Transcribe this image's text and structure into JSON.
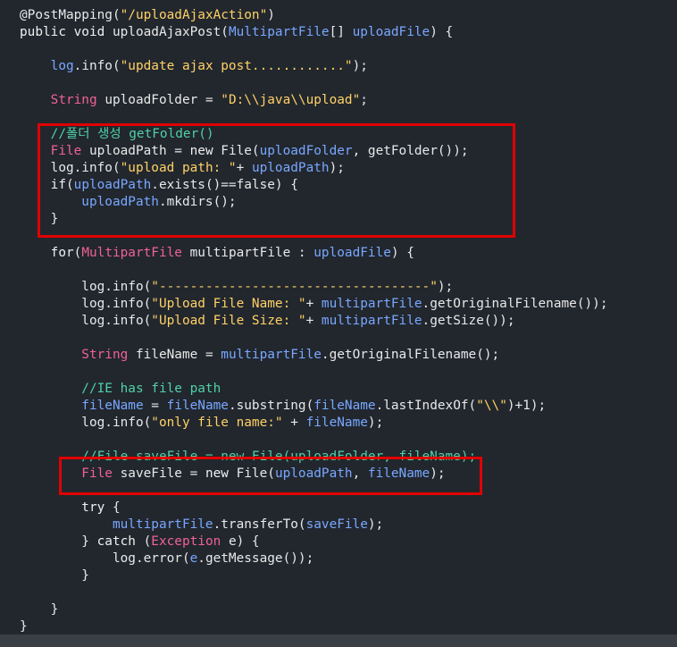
{
  "editor": {
    "background": "#22272e",
    "colors": {
      "keyword": "#f0f0f0",
      "type": "#f06292",
      "string": "#ffd166",
      "identifier": "#79a7ff",
      "comment": "#4fd1a5",
      "plain": "#e8e8e8",
      "highlight_border": "#e00000"
    },
    "lines": [
      [
        [
          "plain",
          "@PostMapping("
        ],
        [
          "string",
          "\"/uploadAjaxAction\""
        ],
        [
          "plain",
          ")"
        ]
      ],
      [
        [
          "keyword",
          "public void "
        ],
        [
          "plain",
          "uploadAjaxPost("
        ],
        [
          "identifier",
          "MultipartFile"
        ],
        [
          "plain",
          "[] "
        ],
        [
          "identifier",
          "uploadFile"
        ],
        [
          "plain",
          ") {"
        ]
      ],
      [],
      [
        [
          "identifier",
          "    log"
        ],
        [
          "plain",
          ".info("
        ],
        [
          "string",
          "\"update ajax post............\""
        ],
        [
          "plain",
          ");"
        ]
      ],
      [],
      [
        [
          "type",
          "    String "
        ],
        [
          "plain",
          "uploadFolder = "
        ],
        [
          "string",
          "\"D:\\\\java\\\\upload\""
        ],
        [
          "plain",
          ";"
        ]
      ],
      [],
      [
        [
          "comment",
          "    //폴더 생성 getFolder()"
        ]
      ],
      [
        [
          "type",
          "    File "
        ],
        [
          "plain",
          "uploadPath = "
        ],
        [
          "keyword",
          "new "
        ],
        [
          "plain",
          "File("
        ],
        [
          "identifier",
          "uploadFolder"
        ],
        [
          "plain",
          ", getFolder());"
        ]
      ],
      [
        [
          "plain",
          "    log.info("
        ],
        [
          "string",
          "\"upload path: \""
        ],
        [
          "plain",
          "+ "
        ],
        [
          "identifier",
          "uploadPath"
        ],
        [
          "plain",
          ");"
        ]
      ],
      [
        [
          "keyword",
          "    if"
        ],
        [
          "plain",
          "("
        ],
        [
          "identifier",
          "uploadPath"
        ],
        [
          "plain",
          ".exists()==false) {"
        ]
      ],
      [
        [
          "identifier",
          "        uploadPath"
        ],
        [
          "plain",
          ".mkdirs();"
        ]
      ],
      [
        [
          "plain",
          "    }"
        ]
      ],
      [],
      [
        [
          "keyword",
          "    for"
        ],
        [
          "plain",
          "("
        ],
        [
          "type",
          "MultipartFile "
        ],
        [
          "plain",
          "multipartFile : "
        ],
        [
          "identifier",
          "uploadFile"
        ],
        [
          "plain",
          ") {"
        ]
      ],
      [],
      [
        [
          "plain",
          "        log.info("
        ],
        [
          "string",
          "\"-----------------------------------\""
        ],
        [
          "plain",
          ");"
        ]
      ],
      [
        [
          "plain",
          "        log.info("
        ],
        [
          "string",
          "\"Upload File Name: \""
        ],
        [
          "plain",
          "+ "
        ],
        [
          "identifier",
          "multipartFile"
        ],
        [
          "plain",
          ".getOriginalFilename());"
        ]
      ],
      [
        [
          "plain",
          "        log.info("
        ],
        [
          "string",
          "\"Upload File Size: \""
        ],
        [
          "plain",
          "+ "
        ],
        [
          "identifier",
          "multipartFile"
        ],
        [
          "plain",
          ".getSize());"
        ]
      ],
      [],
      [
        [
          "type",
          "        String "
        ],
        [
          "plain",
          "fileName = "
        ],
        [
          "identifier",
          "multipartFile"
        ],
        [
          "plain",
          ".getOriginalFilename();"
        ]
      ],
      [],
      [
        [
          "comment",
          "        //IE has file path"
        ]
      ],
      [
        [
          "identifier",
          "        fileName"
        ],
        [
          "plain",
          " = "
        ],
        [
          "identifier",
          "fileName"
        ],
        [
          "plain",
          ".substring("
        ],
        [
          "identifier",
          "fileName"
        ],
        [
          "plain",
          ".lastIndexOf("
        ],
        [
          "string",
          "\"\\\\\""
        ],
        [
          "plain",
          ")+1);"
        ]
      ],
      [
        [
          "plain",
          "        log.info("
        ],
        [
          "string",
          "\"only file name:\""
        ],
        [
          "plain",
          " + "
        ],
        [
          "identifier",
          "fileName"
        ],
        [
          "plain",
          ");"
        ]
      ],
      [],
      [
        [
          "comment",
          "        //File saveFile = new File(uploadFolder, fileName);"
        ]
      ],
      [
        [
          "type",
          "        File "
        ],
        [
          "plain",
          "saveFile = "
        ],
        [
          "keyword",
          "new "
        ],
        [
          "plain",
          "File("
        ],
        [
          "identifier",
          "uploadPath"
        ],
        [
          "plain",
          ", "
        ],
        [
          "identifier",
          "fileName"
        ],
        [
          "plain",
          ");"
        ]
      ],
      [],
      [
        [
          "keyword",
          "        try "
        ],
        [
          "plain",
          "{"
        ]
      ],
      [
        [
          "identifier",
          "            multipartFile"
        ],
        [
          "plain",
          ".transferTo("
        ],
        [
          "identifier",
          "saveFile"
        ],
        [
          "plain",
          ");"
        ]
      ],
      [
        [
          "plain",
          "        } "
        ],
        [
          "keyword",
          "catch "
        ],
        [
          "plain",
          "("
        ],
        [
          "type",
          "Exception "
        ],
        [
          "plain",
          "e) {"
        ]
      ],
      [
        [
          "plain",
          "            log.error("
        ],
        [
          "identifier",
          "e"
        ],
        [
          "plain",
          ".getMessage());"
        ]
      ],
      [
        [
          "plain",
          "        }"
        ]
      ],
      [],
      [
        [
          "plain",
          "    }"
        ]
      ],
      [
        [
          "plain",
          "}"
        ]
      ]
    ]
  },
  "annotations": [
    {
      "name": "highlight-box-getfolder"
    },
    {
      "name": "highlight-box-savefile"
    }
  ]
}
